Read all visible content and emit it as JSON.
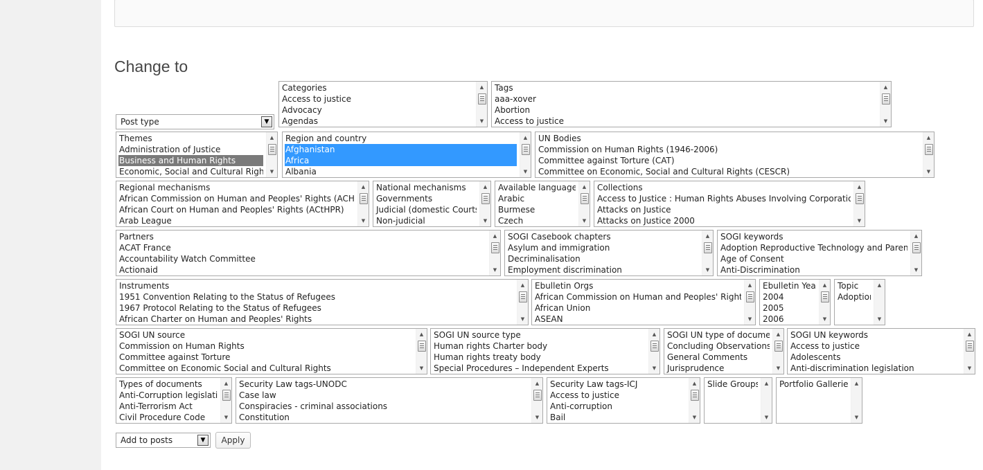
{
  "heading": "Change to",
  "post_type_select": {
    "value": "Post type"
  },
  "action_select": {
    "value": "Add to posts"
  },
  "apply_button": "Apply",
  "listboxes": [
    {
      "name": "categories",
      "items": [
        "Categories",
        "Access to justice",
        "Advocacy",
        "Agendas"
      ]
    },
    {
      "name": "tags",
      "items": [
        "Tags",
        "aaa-xover",
        "Abortion",
        "Access to justice"
      ]
    },
    {
      "name": "themes",
      "items": [
        "Themes",
        "Administration of Justice",
        "Business and Human Rights",
        "Economic, Social and Cultural Rights"
      ],
      "selected": [
        2
      ],
      "selected_style": "inactive"
    },
    {
      "name": "region-and-country",
      "items": [
        "Region and country",
        "Afghanistan",
        "Africa",
        "Albania"
      ],
      "selected": [
        1,
        2
      ],
      "selected_style": "active"
    },
    {
      "name": "un-bodies",
      "items": [
        "UN Bodies",
        "Commission on Human Rights (1946-2006)",
        "Committee against Torture (CAT)",
        "Committee on Economic, Social and Cultural Rights (CESCR)"
      ]
    },
    {
      "name": "regional-mechanisms",
      "items": [
        "Regional mechanisms",
        "African Commission on Human and Peoples' Rights (ACHPR)",
        "African Court on Human and Peoples' Rights (ACtHPR)",
        "Arab League"
      ]
    },
    {
      "name": "national-mechanisms",
      "items": [
        "National mechanisms",
        "Governments",
        "Judicial (domestic Courts)",
        "Non-judicial"
      ]
    },
    {
      "name": "available-languages",
      "items": [
        "Available languages",
        "Arabic",
        "Burmese",
        "Czech"
      ]
    },
    {
      "name": "collections",
      "items": [
        "Collections",
        "Access to Justice : Human Rights Abuses Involving Corporations",
        "Attacks on Justice",
        "Attacks on Justice 2000"
      ]
    },
    {
      "name": "partners",
      "items": [
        "Partners",
        "ACAT France",
        "Accountability Watch Committee",
        "Actionaid"
      ]
    },
    {
      "name": "sogi-casebook-chapters",
      "items": [
        "SOGI Casebook chapters",
        "Asylum and immigration",
        "Decriminalisation",
        "Employment discrimination"
      ]
    },
    {
      "name": "sogi-keywords",
      "items": [
        "SOGI keywords",
        "Adoption Reproductive Technology and Parenting",
        "Age of Consent",
        "Anti-Discrimination"
      ]
    },
    {
      "name": "instruments",
      "items": [
        "Instruments",
        "1951 Convention Relating to the Status of Refugees",
        "1967 Protocol Relating to the Status of Refugees",
        "African Charter on Human and Peoples' Rights"
      ]
    },
    {
      "name": "ebulletin-orgs",
      "items": [
        "Ebulletin Orgs",
        "African Commission on Human and Peoples' Rights",
        "African Union",
        "ASEAN"
      ]
    },
    {
      "name": "ebulletin-year",
      "items": [
        "Ebulletin Year",
        "2004",
        "2005",
        "2006"
      ]
    },
    {
      "name": "topic",
      "items": [
        "Topic",
        "Adoption"
      ]
    },
    {
      "name": "sogi-un-source",
      "items": [
        "SOGI UN source",
        "Commission on Human Rights",
        "Committee against Torture",
        "Committee on Economic Social and Cultural Rights"
      ]
    },
    {
      "name": "sogi-un-source-type",
      "items": [
        "SOGI UN source type",
        "Human rights Charter body",
        "Human rights treaty body",
        "Special Procedures – Independent Experts"
      ]
    },
    {
      "name": "sogi-un-type-of-document",
      "items": [
        "SOGI UN type of document",
        "Concluding Observations",
        "General Comments",
        "Jurisprudence"
      ]
    },
    {
      "name": "sogi-un-keywords",
      "items": [
        "SOGI UN keywords",
        "Access to justice",
        "Adolescents",
        "Anti-discrimination legislation"
      ]
    },
    {
      "name": "types-of-documents",
      "items": [
        "Types of documents",
        "Anti-Corruption legislation",
        "Anti-Terrorism Act",
        "Civil Procedure Code"
      ]
    },
    {
      "name": "security-law-tags-unodc",
      "items": [
        "Security Law tags-UNODC",
        "Case law",
        "Conspiracies - criminal associations",
        "Constitution"
      ]
    },
    {
      "name": "security-law-tags-icj",
      "items": [
        "Security Law tags-ICJ",
        "Access to justice",
        "Anti-corruption",
        "Bail"
      ]
    },
    {
      "name": "slide-groups",
      "items": [
        "Slide Groups"
      ]
    },
    {
      "name": "portfolio-galleries",
      "items": [
        "Portfolio Galleries"
      ]
    }
  ]
}
